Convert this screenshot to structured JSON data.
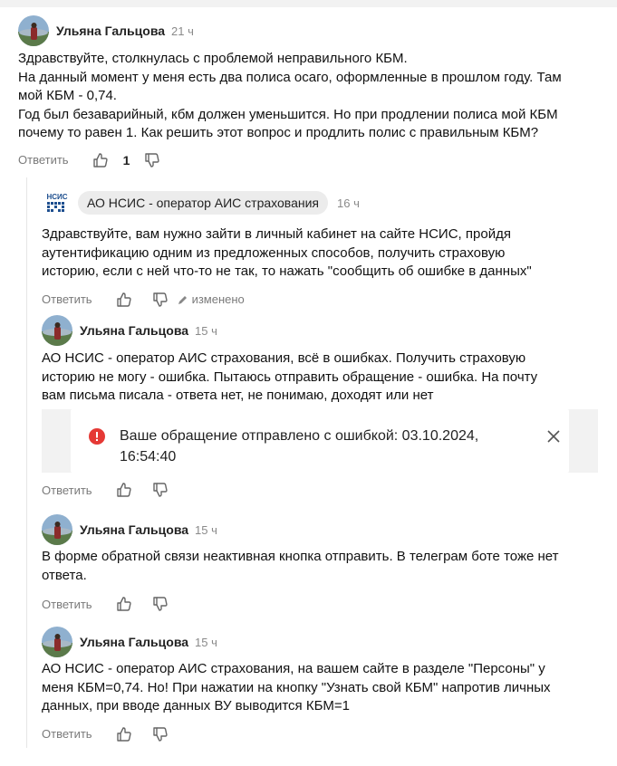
{
  "comments": [
    {
      "author": "Ульяна Гальцова",
      "time": "21 ч",
      "lines": [
        "Здравствуйте, столкнулась с проблемой неправильного КБМ.",
        "На данный момент у меня есть два полиса осаго, оформленные в прошлом году. Там",
        "мой КБМ - 0,74.",
        "Год был безаварийный, кбм должен уменьшится. Но при продлении полиса мой КБМ",
        "почему то равен 1. Как решить этот вопрос и продлить полис с правильным КБМ?"
      ],
      "reply_label": "Ответить",
      "likes": "1"
    },
    {
      "author": "АО НСИС - оператор АИС страхования",
      "time": "16 ч",
      "lines": [
        "Здравствуйте, вам нужно зайти в личный кабинет на сайте НСИС, пройдя",
        "аутентификацию одним из предложенных способов, получить страховую",
        "историю, если с ней что-то не так, то нажать \"сообщить об ошибке в данных\""
      ],
      "reply_label": "Ответить",
      "edited_label": "изменено"
    },
    {
      "author": "Ульяна Гальцова",
      "time": "15 ч",
      "lines": [
        "АО НСИС - оператор АИС страхования, всё в ошибках. Получить страховую",
        "историю не могу - ошибка. Пытаюсь отправить обращение - ошибка. На почту",
        "вам письма писала - ответа нет, не понимаю, доходят или нет"
      ],
      "attachment_text": "Ваше обращение отправлено с ошибкой: 03.10.2024, 16:54:40",
      "reply_label": "Ответить"
    },
    {
      "author": "Ульяна Гальцова",
      "time": "15 ч",
      "lines": [
        "В форме обратной связи неактивная кнопка отправить. В телеграм боте тоже нет",
        "ответа."
      ],
      "reply_label": "Ответить"
    },
    {
      "author": "Ульяна Гальцова",
      "time": "15 ч",
      "lines": [
        "АО НСИС - оператор АИС страхования, на вашем сайте в разделе \"Персоны\" у",
        "меня КБМ=0,74. Но! При нажатии на кнопку \"Узнать свой КБМ\" напротив личных",
        "данных, при вводе данных ВУ выводится КБМ=1"
      ],
      "reply_label": "Ответить"
    }
  ],
  "logo_text": "НСИС",
  "icons": [
    "thumbs-up-icon",
    "thumbs-down-icon",
    "pencil-icon",
    "error-icon",
    "close-icon"
  ],
  "colors": {
    "error": "#e53935",
    "muted": "#7a7a7a",
    "badge_bg": "#ececec"
  }
}
